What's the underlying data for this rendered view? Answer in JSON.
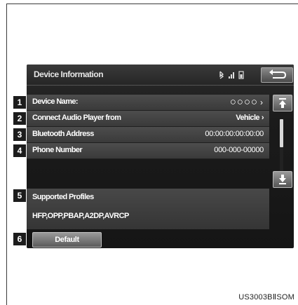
{
  "screen": {
    "title": "Device Information",
    "back_icon": "back-arrow-icon",
    "status_icons": [
      "bluetooth-icon",
      "signal-strength-icon",
      "battery-icon"
    ]
  },
  "rows": [
    {
      "callout": "1",
      "label": "Device Name:",
      "value": "○○○○",
      "chevron": "›"
    },
    {
      "callout": "2",
      "label": "Connect Audio Player from",
      "value": "Vehicle",
      "chevron": "›"
    },
    {
      "callout": "3",
      "label": "Bluetooth Address",
      "value": "00:00:00:00:00:00",
      "chevron": ""
    },
    {
      "callout": "4",
      "label": "Phone Number",
      "value": "000-000-00000",
      "chevron": ""
    }
  ],
  "profiles": {
    "callout": "5",
    "title": "Supported Profiles",
    "value": "HFP,OPP,PBAP,A2DP,AVRCP"
  },
  "default_button": {
    "callout": "6",
    "label": "Default"
  },
  "scroll": {
    "up_icon": "scroll-up-icon",
    "down_icon": "scroll-down-icon"
  },
  "caption": "US3003BⅡSOM"
}
